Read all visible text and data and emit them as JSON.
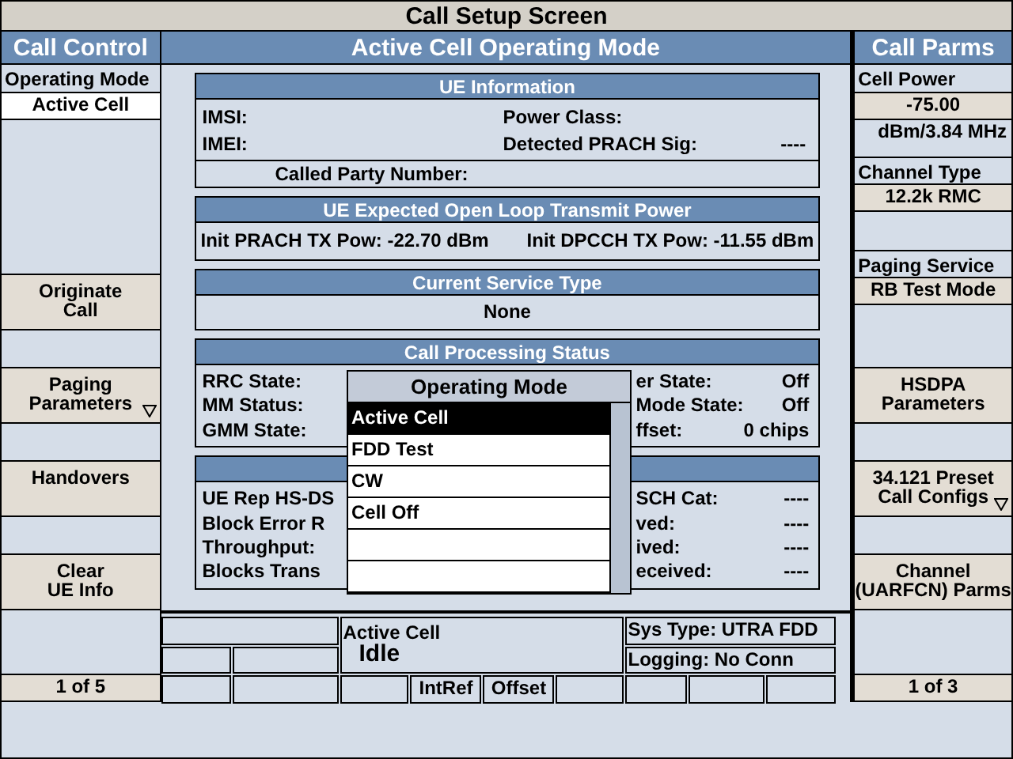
{
  "title": "Call Setup Screen",
  "left_column": {
    "title": "Call Control",
    "items": [
      {
        "kind": "label",
        "text": "Operating Mode"
      },
      {
        "kind": "field",
        "text": "Active Cell"
      }
    ],
    "softkeys": [
      {
        "label": "Originate\nCall",
        "more": false
      },
      {
        "label": "Paging\nParameters",
        "more": true
      },
      {
        "label": "Handovers",
        "more": false
      },
      {
        "label": "Clear\nUE Info",
        "more": false
      }
    ],
    "page": "1 of 5"
  },
  "center": {
    "title": "Active Cell Operating Mode",
    "panels": [
      {
        "kind": "ue_info",
        "title": "UE Information",
        "left": [
          "IMSI:",
          "IMEI:"
        ],
        "right": [
          {
            "label": "Power Class:"
          },
          {
            "label": "Detected PRACH Sig:",
            "value": "----"
          }
        ],
        "footer": "Called Party Number:"
      },
      {
        "kind": "pair",
        "title": "UE Expected Open Loop Transmit Power",
        "cells": [
          "Init PRACH TX Pow: -22.70 dBm",
          "Init DPCCH TX Pow: -11.55 dBm"
        ]
      },
      {
        "kind": "single",
        "title": "Current Service Type",
        "text": "None"
      },
      {
        "kind": "split",
        "title": "Call Processing Status",
        "rows": [
          {
            "left": "RRC State:",
            "right": "er State:",
            "value": "Off"
          },
          {
            "left": "MM Status:",
            "right": "Mode State:",
            "value": "Off"
          },
          {
            "left": "GMM State:",
            "right": "ffset:",
            "value": "0 chips"
          }
        ]
      },
      {
        "kind": "split",
        "rows": [
          {
            "left": "UE Rep HS-DS",
            "right": "SCH Cat:",
            "value": "----"
          },
          {
            "left": "Block Error R",
            "right": "ved:",
            "value": "----"
          },
          {
            "left": "Throughput:",
            "right": "ived:",
            "value": "----"
          },
          {
            "left": "Blocks Trans",
            "right": "eceived:",
            "value": "----"
          }
        ]
      }
    ]
  },
  "popup": {
    "title": "Operating Mode",
    "options": [
      {
        "label": "Active Cell",
        "selected": true
      },
      {
        "label": "FDD Test",
        "selected": false
      },
      {
        "label": "CW",
        "selected": false
      },
      {
        "label": "Cell Off",
        "selected": false
      }
    ]
  },
  "status": {
    "connection_label": "Active Cell",
    "connection_state": "Idle",
    "sys_type": "Sys Type: UTRA FDD",
    "logging": "Logging: No Conn",
    "indicators": [
      "IntRef",
      "Offset"
    ]
  },
  "right_column": {
    "title": "Call Parms",
    "items": [
      {
        "kind": "label",
        "text": "Cell Power"
      },
      {
        "kind": "field",
        "text": "-75.00"
      },
      {
        "kind": "unit",
        "text": "dBm/3.84 MHz"
      },
      {
        "kind": "label",
        "text": "Channel Type"
      },
      {
        "kind": "field",
        "text": "12.2k RMC"
      },
      {
        "kind": "label",
        "text": "Paging Service"
      },
      {
        "kind": "field",
        "text": "RB Test Mode"
      }
    ],
    "softkeys": [
      {
        "label": "HSDPA\nParameters",
        "more": false
      },
      {
        "label": "34.121 Preset\nCall Configs",
        "more": true
      },
      {
        "label": "Channel\n(UARFCN) Parms",
        "more": false
      }
    ],
    "page": "1 of 3"
  }
}
